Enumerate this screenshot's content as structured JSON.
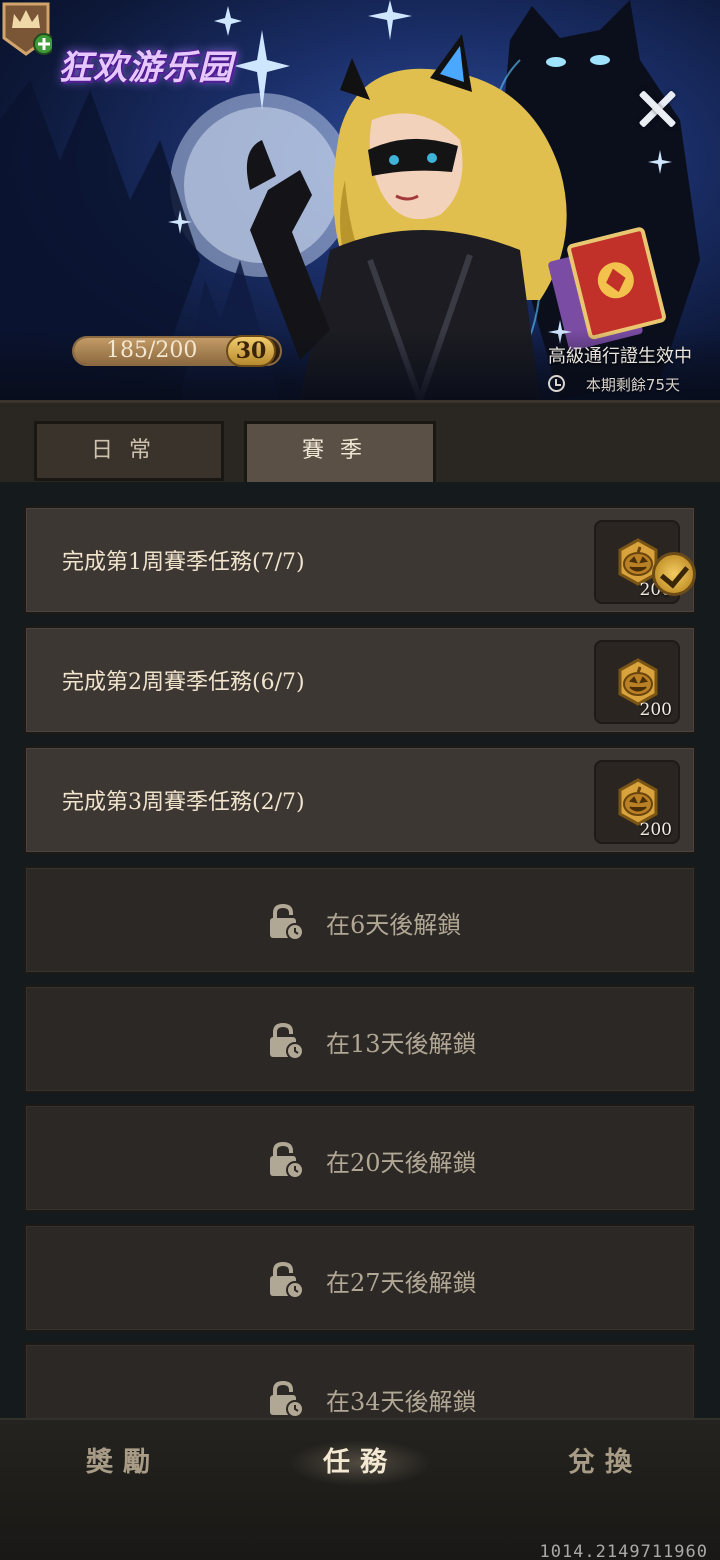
{
  "banner": {
    "logo_text": "狂欢游乐园",
    "progress_text": "185/200",
    "progress_fraction": 0.925,
    "level": "30",
    "pass_status": "高級通行證生效中",
    "season_remaining": "本期剩餘75天"
  },
  "tabs": [
    {
      "label": "日常",
      "active": false
    },
    {
      "label": "賽季",
      "active": true
    }
  ],
  "tasks": [
    {
      "title": "完成第1周賽季任務(7/7)",
      "reward": "200",
      "claimed": true
    },
    {
      "title": "完成第2周賽季任務(6/7)",
      "reward": "200",
      "claimed": false
    },
    {
      "title": "完成第3周賽季任務(2/7)",
      "reward": "200",
      "claimed": false
    }
  ],
  "locked": [
    {
      "label": "在6天後解鎖"
    },
    {
      "label": "在13天後解鎖"
    },
    {
      "label": "在20天後解鎖"
    },
    {
      "label": "在27天後解鎖"
    },
    {
      "label": "在34天後解鎖"
    }
  ],
  "nav": {
    "rewards": "獎勵",
    "tasks": "任務",
    "exchange": "兌換",
    "active": "tasks"
  },
  "build_id": "1014.2149711960",
  "colors": {
    "accent_gold": "#d9a93f",
    "card_bg": "#3d3733",
    "locked_card_bg": "#2c2825",
    "page_bg": "#151a1d"
  }
}
